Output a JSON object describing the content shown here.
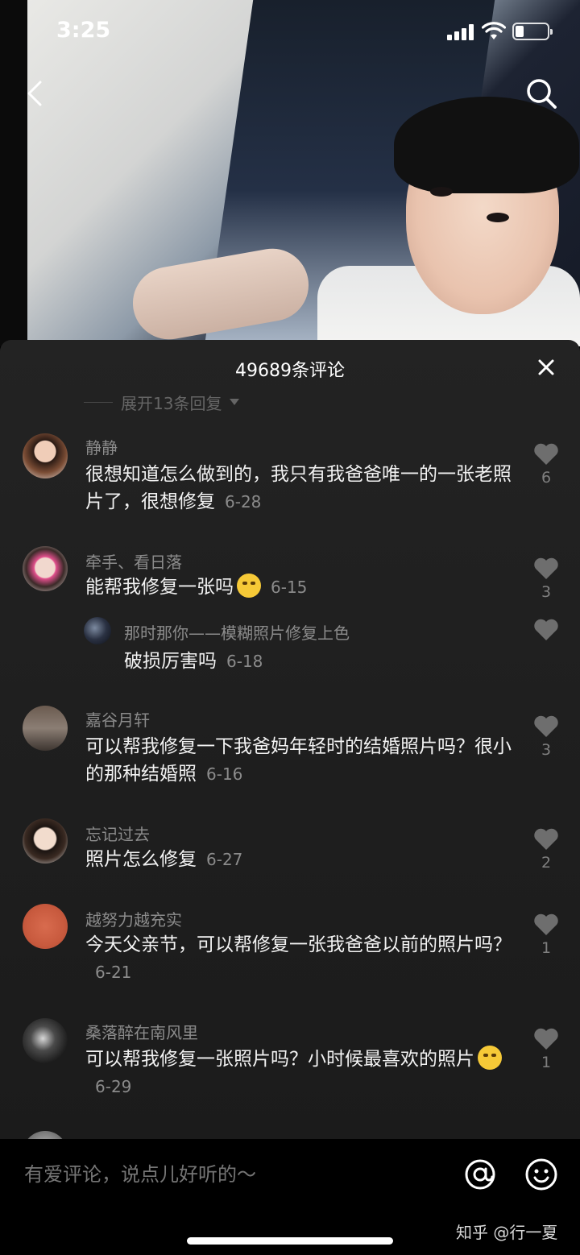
{
  "status_bar": {
    "time": "3:25"
  },
  "sheet": {
    "title": "49689条评论",
    "expand_replies": "展开13条回复"
  },
  "comments": [
    {
      "user": "静静",
      "text": "很想知道怎么做到的，我只有我爸爸唯一的一张老照片了，很想修复",
      "date": "6-28",
      "likes": "6"
    },
    {
      "user": "牵手、看日落",
      "text": "能帮我修复一张吗",
      "date": "6-15",
      "likes": "3"
    },
    {
      "user": "那时那你——模糊照片修复上色",
      "text": "破损厉害吗",
      "date": "6-18",
      "likes": ""
    },
    {
      "user": "嘉谷月轩",
      "text": "可以帮我修复一下我爸妈年轻时的结婚照片吗？很小的那种结婚照",
      "date": "6-16",
      "likes": "3"
    },
    {
      "user": "忘记过去",
      "text": "照片怎么修复",
      "date": "6-27",
      "likes": "2"
    },
    {
      "user": "越努力越充实",
      "text": "今天父亲节，可以帮修复一张我爸爸以前的照片吗？",
      "date": "6-21",
      "likes": "1"
    },
    {
      "user": "桑落醉在南风里",
      "text": "可以帮我修复一张照片吗？小时候最喜欢的照片",
      "date": "6-29",
      "likes": "1"
    }
  ],
  "input": {
    "placeholder": "有爱评论，说点儿好听的～"
  },
  "watermark": "知乎 @行一夏",
  "colors": {
    "sheet_bg": "#1f1f1f",
    "muted_text": "#8b8b8b",
    "body_text": "#f2f2f2"
  }
}
